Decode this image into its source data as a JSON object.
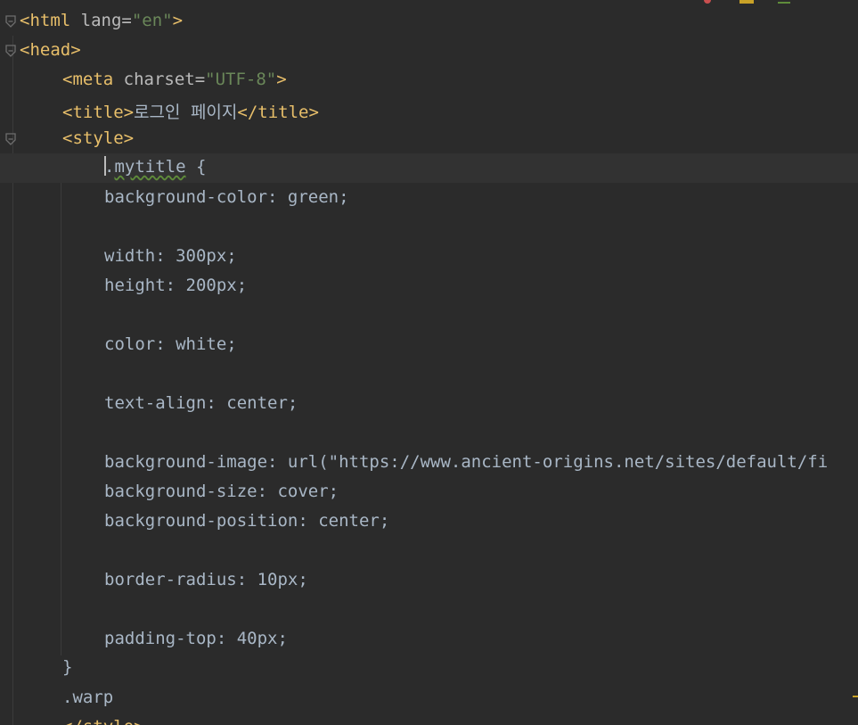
{
  "editor": {
    "theme": {
      "background": "#2b2b2b",
      "current_line": "#323232",
      "tag": "#e8bf6a",
      "string": "#6a8759",
      "text": "#a9b7c6"
    },
    "lines": {
      "html_open": {
        "tag_open": "<html",
        "attr": " lang=",
        "value": "\"en\"",
        "tag_close": ">"
      },
      "head_open": {
        "tag": "<head>"
      },
      "meta": {
        "tag_open": "<meta",
        "attr": " charset=",
        "value": "\"UTF-8\"",
        "tag_close": ">"
      },
      "title": {
        "open": "<title>",
        "text": "로그인 페이지",
        "close": "</title>"
      },
      "style_open": {
        "tag": "<style>"
      },
      "selector": {
        "dot": ".",
        "name": "mytitle",
        "brace": " {"
      },
      "bg_color": "background-color: green;",
      "width": "width: 300px;",
      "height": "height: 200px;",
      "color": "color: white;",
      "text_align": "text-align: center;",
      "bg_image": "background-image: url(\"https://www.ancient-origins.net/sites/default/fi",
      "bg_size": "background-size: cover;",
      "bg_position": "background-position: center;",
      "border_radius": "border-radius: 10px;",
      "padding_top": "padding-top: 40px;",
      "close_brace": "}",
      "warp": ".warp",
      "style_close": "</style>"
    }
  }
}
